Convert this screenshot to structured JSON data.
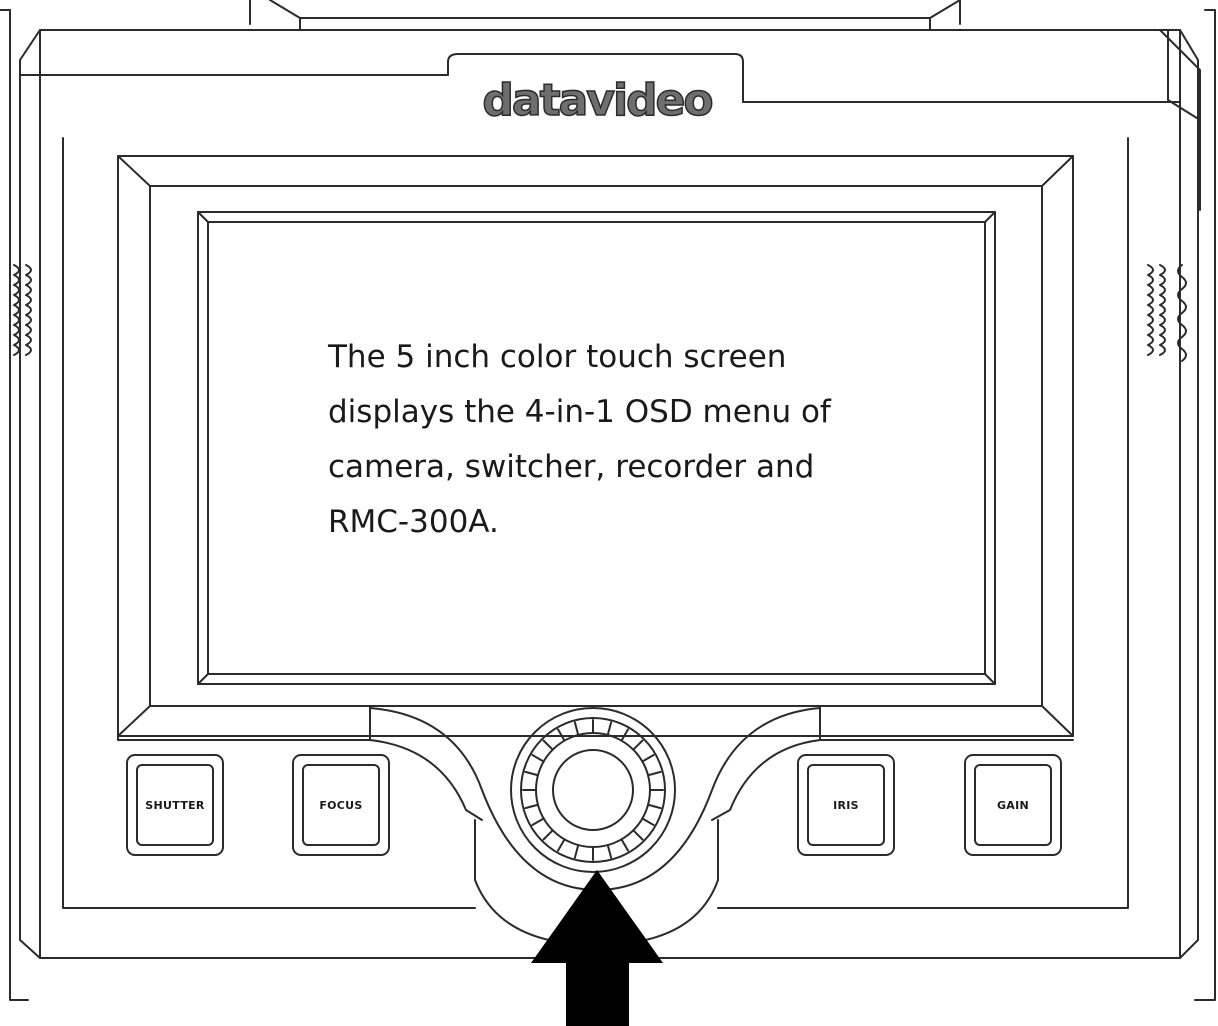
{
  "brand": {
    "logo_text": "datavideo"
  },
  "screen": {
    "description_lines": [
      "The 5 inch color touch screen",
      "displays the 4-in-1 OSD menu of",
      "camera, switcher, recorder and",
      "RMC-300A."
    ]
  },
  "buttons": {
    "shutter": "SHUTTER",
    "focus": "FOCUS",
    "iris": "IRIS",
    "gain": "GAIN"
  },
  "colors": {
    "outline": "#2b2b2b",
    "arrow": "#000000",
    "background": "#ffffff"
  }
}
